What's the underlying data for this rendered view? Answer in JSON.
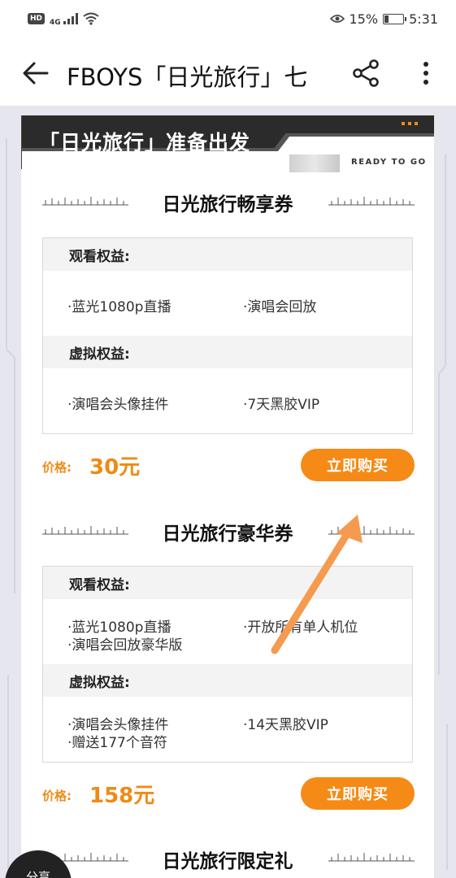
{
  "status_bar": {
    "hd": "HD",
    "network": "4G",
    "battery_percent": "15%",
    "time": "5:31"
  },
  "app_bar": {
    "title": "FBOYS「日光旅行」七",
    "back_icon": "back-arrow-icon",
    "share_icon": "share-icon",
    "more_icon": "more-vertical-icon"
  },
  "header": {
    "title": "「日光旅行」准备出发",
    "tagline": "READY TO GO"
  },
  "tickets": [
    {
      "name": "日光旅行畅享券",
      "watch_heading": "观看权益:",
      "watch_items": [
        "·蓝光1080p直播",
        "·演唱会回放"
      ],
      "virtual_heading": "虚拟权益:",
      "virtual_items": [
        "·演唱会头像挂件",
        "·7天黑胶VIP"
      ],
      "price_label": "价格:",
      "price": "30元",
      "buy_label": "立即购买"
    },
    {
      "name": "日光旅行豪华券",
      "watch_heading": "观看权益:",
      "watch_items": [
        "·蓝光1080p直播",
        "·开放所有单人机位",
        "·演唱会回放豪华版"
      ],
      "virtual_heading": "虚拟权益:",
      "virtual_items": [
        "·演唱会头像挂件",
        "·14天黑胶VIP",
        "·赠送177个音符"
      ],
      "price_label": "价格:",
      "price": "158元",
      "buy_label": "立即购买"
    },
    {
      "name": "日光旅行限定礼"
    }
  ],
  "share_fab_label": "分享",
  "colors": {
    "accent": "#f68a16",
    "header_dark": "#2b2b2b",
    "page_bg": "#e5e6ee",
    "annotation_arrow": "#f59a4e"
  }
}
